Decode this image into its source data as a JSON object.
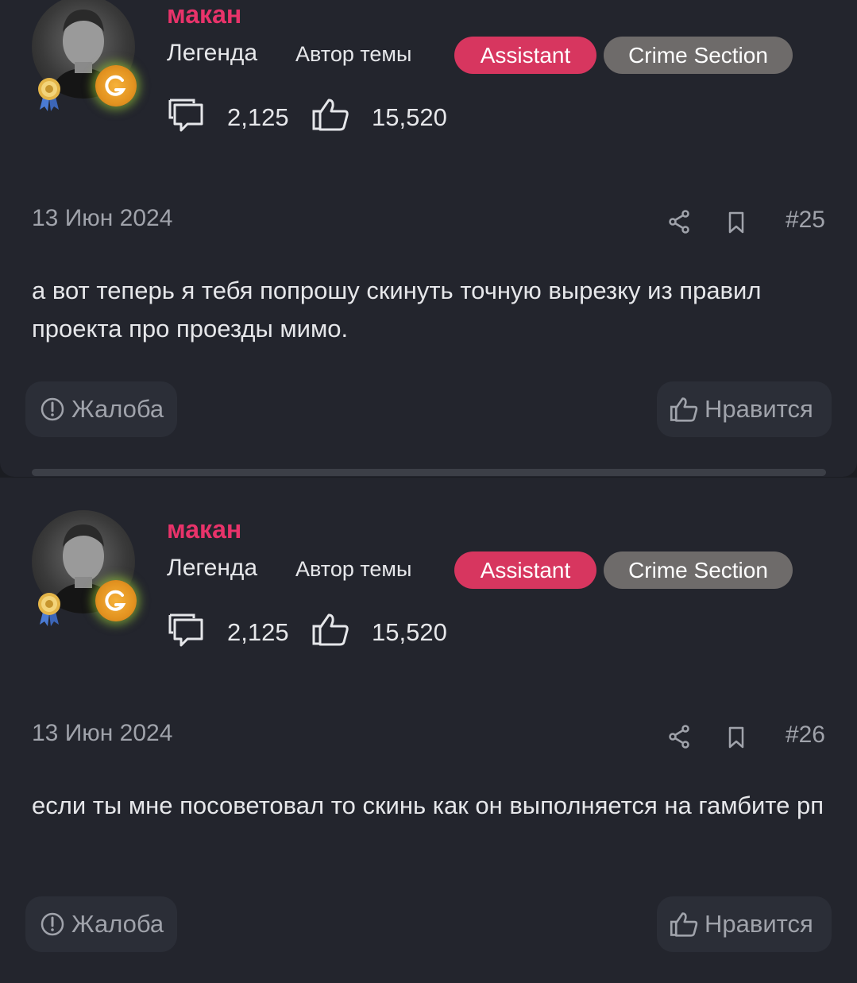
{
  "posts": [
    {
      "username": "макан",
      "rank": "Легенда",
      "author_label": "Автор темы",
      "badges": [
        "Assistant",
        "Crime Section"
      ],
      "messages_count": "2,125",
      "likes_count": "15,520",
      "date": "13 Июн 2024",
      "post_number": "#25",
      "text": "а вот теперь я тебя попрошу скинуть точную вырезку из правил проекта про проезды мимо.",
      "report_label": "Жалоба",
      "like_label": "Нравится"
    },
    {
      "username": "макан",
      "rank": "Легенда",
      "author_label": "Автор темы",
      "badges": [
        "Assistant",
        "Crime Section"
      ],
      "messages_count": "2,125",
      "likes_count": "15,520",
      "date": "13 Июн 2024",
      "post_number": "#26",
      "text": "если ты мне посоветовал то скинь как он выполняется на гамбите рп",
      "report_label": "Жалоба",
      "like_label": "Нравится"
    }
  ],
  "icons": {
    "messages": "speech-bubbles-icon",
    "likes": "thumbs-up-icon",
    "share": "share-icon",
    "bookmark": "bookmark-icon",
    "report": "exclamation-circle-icon"
  },
  "colors": {
    "username": "#e8336a",
    "assistant_badge": "#d7365f",
    "crime_badge": "#6e6b6a",
    "background": "#23252d"
  }
}
